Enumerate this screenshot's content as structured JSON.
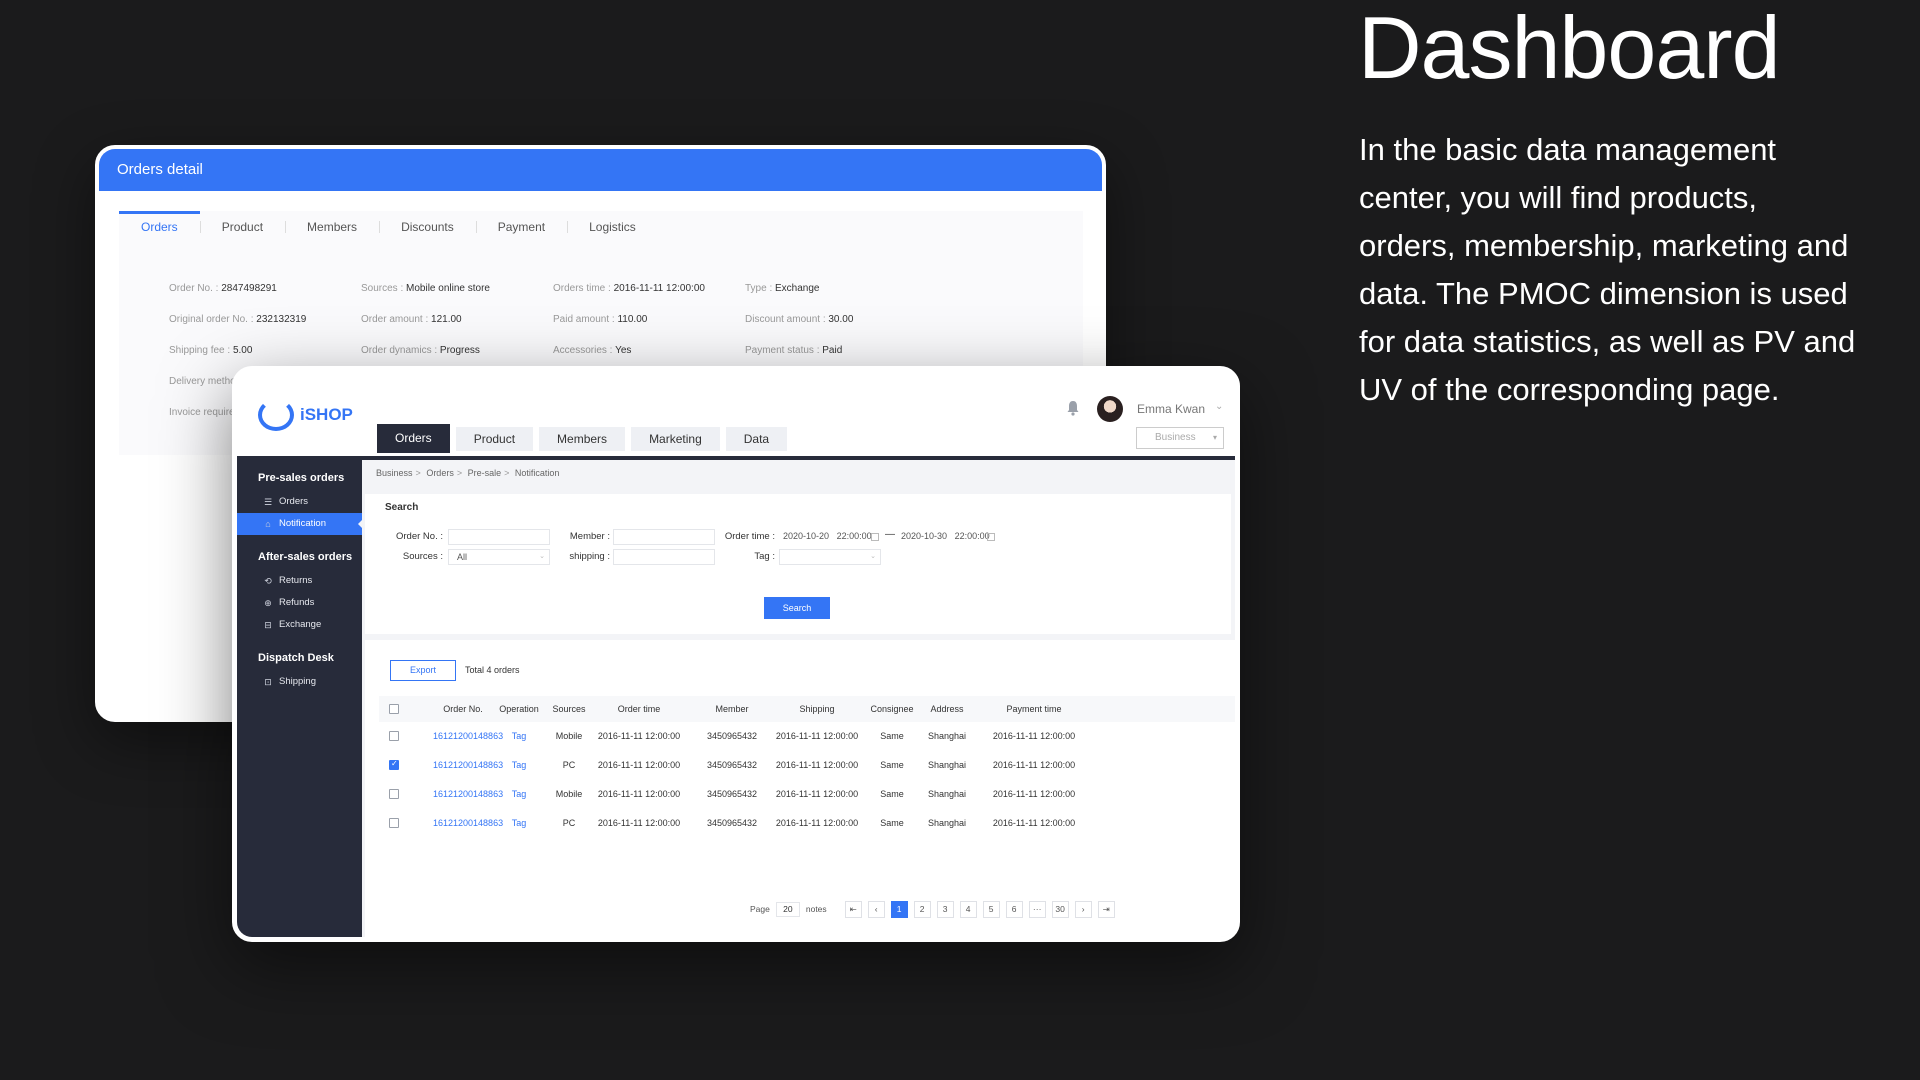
{
  "hero": {
    "title": "Dashboard",
    "description": "In the basic data management center, you will find products, orders, membership, marketing and data. The PMOC dimension is used for data statistics, as well as PV and UV of the corresponding page."
  },
  "orders_detail": {
    "title": "Orders detail",
    "tabs": [
      "Orders",
      "Product",
      "Members",
      "Discounts",
      "Payment",
      "Logistics"
    ],
    "active_tab": "Orders",
    "rows": [
      [
        {
          "label": "Order No. : ",
          "value": "2847498291"
        },
        {
          "label": "Sources : ",
          "value": "Mobile online store"
        },
        {
          "label": "Orders time : ",
          "value": "2016-11-11 12:00:00"
        },
        {
          "label": "Type : ",
          "value": "Exchange"
        }
      ],
      [
        {
          "label": "Original order No. : ",
          "value": "232132319"
        },
        {
          "label": "Order amount : ",
          "value": "121.00"
        },
        {
          "label": "Paid amount : ",
          "value": "110.00"
        },
        {
          "label": "Discount amount : ",
          "value": "30.00"
        }
      ],
      [
        {
          "label": "Shipping fee : ",
          "value": "5.00"
        },
        {
          "label": "Order dynamics : ",
          "value": "Progress"
        },
        {
          "label": "Accessories : ",
          "value": "Yes"
        },
        {
          "label": "Payment status : ",
          "value": "Paid"
        }
      ],
      [
        {
          "label": "Delivery metho",
          "value": ""
        }
      ],
      [
        {
          "label": "Invoice require",
          "value": ""
        }
      ]
    ]
  },
  "app": {
    "logo_text": "iSHOP",
    "nav_tabs": [
      "Orders",
      "Product",
      "Members",
      "Marketing",
      "Data"
    ],
    "active_nav": "Orders",
    "user_name": "Emma Kwan",
    "business_select": "Business",
    "accent": "#3475f5",
    "sidebar_bg": "#272b3a"
  },
  "sidebar": {
    "groups": [
      {
        "title": "Pre-sales orders",
        "items": [
          {
            "label": "Orders",
            "icon": "list-icon"
          },
          {
            "label": "Notification",
            "icon": "bell-icon",
            "active": true
          }
        ]
      },
      {
        "title": "After-sales orders",
        "items": [
          {
            "label": "Returns",
            "icon": "return-icon"
          },
          {
            "label": "Refunds",
            "icon": "refund-icon"
          },
          {
            "label": "Exchange",
            "icon": "exchange-icon"
          }
        ]
      },
      {
        "title": "Dispatch Desk",
        "items": [
          {
            "label": "Shipping",
            "icon": "box-icon"
          }
        ]
      }
    ]
  },
  "breadcrumb": [
    "Business",
    "Orders",
    "Pre-sale",
    "Notification"
  ],
  "search": {
    "title": "Search",
    "order_no_label": "Order No. :",
    "member_label": "Member :",
    "order_time_label": "Order time :",
    "date_from": "2020-10-20",
    "time_from": "22:00:00",
    "date_to": "2020-10-30",
    "time_to": "22:00:00",
    "sources_label": "Sources :",
    "sources_value": "All",
    "shipping_label": "shipping :",
    "tag_label": "Tag :",
    "button": "Search"
  },
  "table": {
    "export_label": "Export",
    "total_label": "Total 4 orders",
    "columns": [
      "Order No.",
      "Operation",
      "Sources",
      "Order time",
      "Member",
      "Shipping",
      "Consignee",
      "Address",
      "Payment time"
    ],
    "rows": [
      {
        "checked": false,
        "cells": [
          "16121200148863",
          "Tag",
          "Mobile",
          "2016-11-11  12:00:00",
          "3450965432",
          "2016-11-11  12:00:00",
          "Same",
          "Shanghai",
          "2016-11-11  12:00:00"
        ]
      },
      {
        "checked": true,
        "cells": [
          "16121200148863",
          "Tag",
          "PC",
          "2016-11-11  12:00:00",
          "3450965432",
          "2016-11-11  12:00:00",
          "Same",
          "Shanghai",
          "2016-11-11  12:00:00"
        ]
      },
      {
        "checked": false,
        "cells": [
          "16121200148863",
          "Tag",
          "Mobile",
          "2016-11-11  12:00:00",
          "3450965432",
          "2016-11-11  12:00:00",
          "Same",
          "Shanghai",
          "2016-11-11  12:00:00"
        ]
      },
      {
        "checked": false,
        "cells": [
          "16121200148863",
          "Tag",
          "PC",
          "2016-11-11  12:00:00",
          "3450965432",
          "2016-11-11  12:00:00",
          "Same",
          "Shanghai",
          "2016-11-11  12:00:00"
        ]
      }
    ]
  },
  "pagination": {
    "page_label": "Page",
    "page_size": "20",
    "notes_label": "notes",
    "pages": [
      "1",
      "2",
      "3",
      "4",
      "5",
      "6",
      "···",
      "30"
    ],
    "current": "1",
    "first_icon": "first-page-icon",
    "prev_icon": "chevron-left-icon",
    "next_icon": "chevron-right-icon",
    "last_icon": "last-page-icon"
  }
}
